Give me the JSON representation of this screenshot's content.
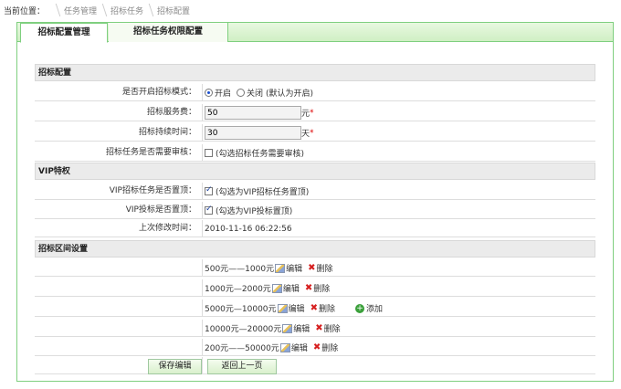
{
  "breadcrumb": {
    "lead": "当前位置：",
    "items": [
      "任务管理",
      "招标任务",
      "招标配置"
    ]
  },
  "tabs": [
    {
      "label": "招标配置管理"
    },
    {
      "label": "招标任务权限配置"
    }
  ],
  "sections": {
    "tender": "招标配置",
    "vip": "VIP特权",
    "range": "招标区间设置"
  },
  "fields": {
    "enable_label": "是否开启招标模式：",
    "enable_on": "开启",
    "enable_off": "关闭",
    "enable_hint": "(默认为开启)",
    "fee_label": "招标服务费：",
    "fee_value": "50",
    "fee_unit": "元",
    "duration_label": "招标持续时间：",
    "duration_value": "30",
    "duration_unit": "天",
    "review_label": "招标任务是否需要审核：",
    "review_hint": "(勾选招标任务需要审核)",
    "vip_top_label": "VIP招标任务是否置顶：",
    "vip_top_hint": "(勾选为VIP招标任务置顶)",
    "vip_bid_label": "VIP投标是否置顶：",
    "vip_bid_hint": "(勾选为VIP投标置顶)",
    "modified_label": "上次修改时间：",
    "modified_value": "2010-11-16 06:22:56",
    "required_mark": "*"
  },
  "ranges": [
    {
      "text": "500元——1000元",
      "edit": "编辑",
      "delete": "删除"
    },
    {
      "text": "1000元—2000元",
      "edit": "编辑",
      "delete": "删除"
    },
    {
      "text": "5000元—10000元",
      "edit": "编辑",
      "delete": "删除",
      "add": "添加"
    },
    {
      "text": "10000元—20000元",
      "edit": "编辑",
      "delete": "删除"
    },
    {
      "text": "200元——50000元",
      "edit": "编辑",
      "delete": "删除"
    }
  ],
  "buttons": {
    "save": "保存编辑",
    "back": "返回上一页"
  },
  "colors": {
    "accent_green": "#7fcf7f",
    "section_bg": "#ebebeb",
    "required": "#dd0000"
  }
}
